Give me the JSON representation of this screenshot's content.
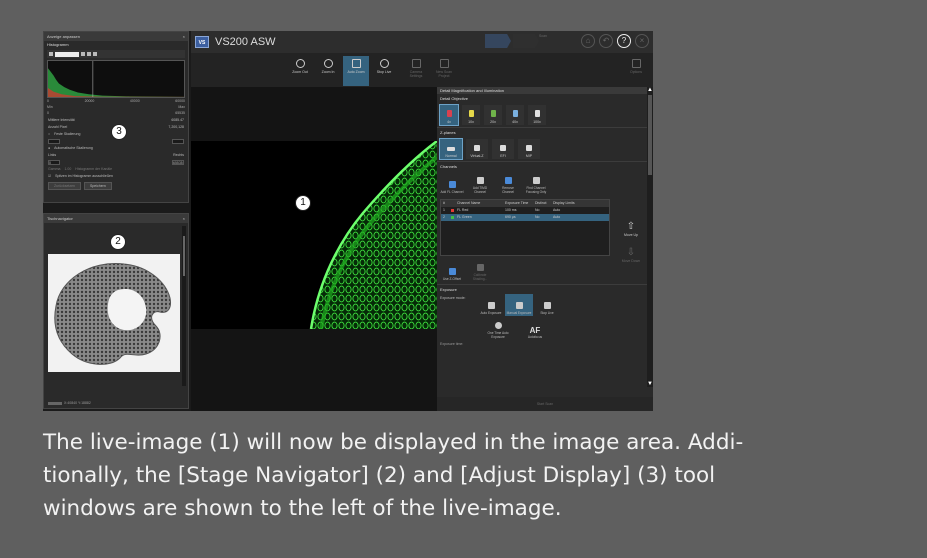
{
  "adjust_display": {
    "title": "Anzeige anpassen",
    "histogram_label": "Histogramm",
    "channel_select": "Alle Kanäle",
    "axis_min": "Min",
    "axis_max": "Max",
    "axis_ticks": [
      "0",
      "20000",
      "40000",
      "60000"
    ],
    "axis_range_start": "0",
    "axis_range_end": "65535",
    "mittlere_intensitaet": "Mittlere Intensität",
    "mittlere_intensitaet_value": "6085.47",
    "anzahl_pixel": "Anzahl Pixel",
    "anzahl_pixel_value": "7,200,128",
    "feste_skalierung": "Feste Skalierung",
    "links": "Links",
    "rechts": "Rechts",
    "left_value": "0",
    "right_value": "65535",
    "automatische_einstellung": "Automatische Skalierung",
    "gamma_label": "Gamma",
    "gamma_value": "1.00",
    "histogram_line": "Histogramm der Kanäle",
    "spitzen_checkbox": "Spitzen im Histogramm ausschließen",
    "zuruecksetzen": "Zurücksetzen",
    "speichern": "Speichern",
    "gear_icon": "gear-icon"
  },
  "stage_navigator": {
    "title": "Tischnavigator",
    "status": "X:40840 Y:18882"
  },
  "app": {
    "logo": "VS",
    "name": "VS200 ASW",
    "step_label": "Scan",
    "toolbar": [
      {
        "label": "Zoom Out",
        "icon": "zoom-out-icon",
        "state": "normal"
      },
      {
        "label": "Zoom In",
        "icon": "zoom-in-icon",
        "state": "normal"
      },
      {
        "label": "Auto Zoom",
        "icon": "auto-zoom-icon",
        "state": "active"
      },
      {
        "label": "Stop Live",
        "icon": "camera-icon",
        "state": "normal"
      },
      {
        "label": "Camera Settings",
        "icon": "camera-settings-icon",
        "state": "dim"
      },
      {
        "label": "New Scan Project",
        "icon": "new-project-icon",
        "state": "dim"
      },
      {
        "label": "Options",
        "icon": "gear-icon",
        "state": "dim"
      }
    ],
    "window_controls": [
      "home-icon",
      "back-icon",
      "help-icon",
      "close-icon"
    ]
  },
  "panel": {
    "header": "Detail Magnification and Illumination",
    "detail_objective": "Detail Objective",
    "objectives": [
      {
        "label": "4x",
        "color": "#d9414f",
        "selected": true
      },
      {
        "label": "10x",
        "color": "#e7d94a",
        "selected": false
      },
      {
        "label": "20x",
        "color": "#6fb34a",
        "selected": false
      },
      {
        "label": "40x",
        "color": "#7ab0e0",
        "selected": false
      },
      {
        "label": "100x",
        "color": "#e0e0e0",
        "selected": false
      }
    ],
    "z_planes": "Z-planes",
    "z_options": [
      {
        "label": "Normal",
        "selected": true
      },
      {
        "label": "Virtual-Z",
        "selected": false
      },
      {
        "label": "EFI",
        "selected": false
      },
      {
        "label": "MIP",
        "selected": false
      }
    ],
    "channels": "Channels",
    "channel_buttons": [
      {
        "label": "Add FL Channel",
        "dim": false
      },
      {
        "label": "Add TIMD Channel",
        "dim": false
      },
      {
        "label": "Remove Channel",
        "dim": false
      },
      {
        "label": "Find Channel Focusing Only",
        "dim": false
      }
    ],
    "table_headers": [
      "#",
      "",
      "Channel Name",
      "Exposure Time",
      "Distinct",
      "Display Limits"
    ],
    "table_rows": [
      {
        "no": "1",
        "color": "#e53935",
        "name": "FL Red",
        "exposure": "100 ms",
        "distinct": "No",
        "limits": "Auto",
        "selected": false
      },
      {
        "no": "2",
        "color": "#43c043",
        "name": "FL Green",
        "exposure": "690 µs",
        "distinct": "No",
        "limits": "Auto",
        "selected": true
      }
    ],
    "move_up": "Move Up",
    "move_down": "Move Down",
    "use_z_offset": "Use Z-Offset",
    "calibrate": "Calibrate Shading...",
    "exposure": "Exposure",
    "exposure_mode": "Exposure mode:",
    "exposure_buttons": [
      {
        "label": "Auto Exposure",
        "active": false
      },
      {
        "label": "Manual Exposure",
        "active": true
      },
      {
        "label": "Stop Live",
        "active": false
      }
    ],
    "one_time": "One Time Auto Exposure",
    "af_label": "AF",
    "autofocus": "Autofocus",
    "exposure_time": "Exposure time:",
    "start_button": "Start Scan"
  },
  "callouts": [
    "1",
    "2",
    "3"
  ],
  "caption": {
    "part1": "The live-image ",
    "num1": "(1)",
    "part2": " will now be displayed in the image area. Addi-\ntionally, the [Stage Navigator] ",
    "num2": "(2)",
    "part3": " and [Adjust Display] ",
    "num3": "(3)",
    "part4": " tool\nwindows are shown to the left of the live-image."
  }
}
